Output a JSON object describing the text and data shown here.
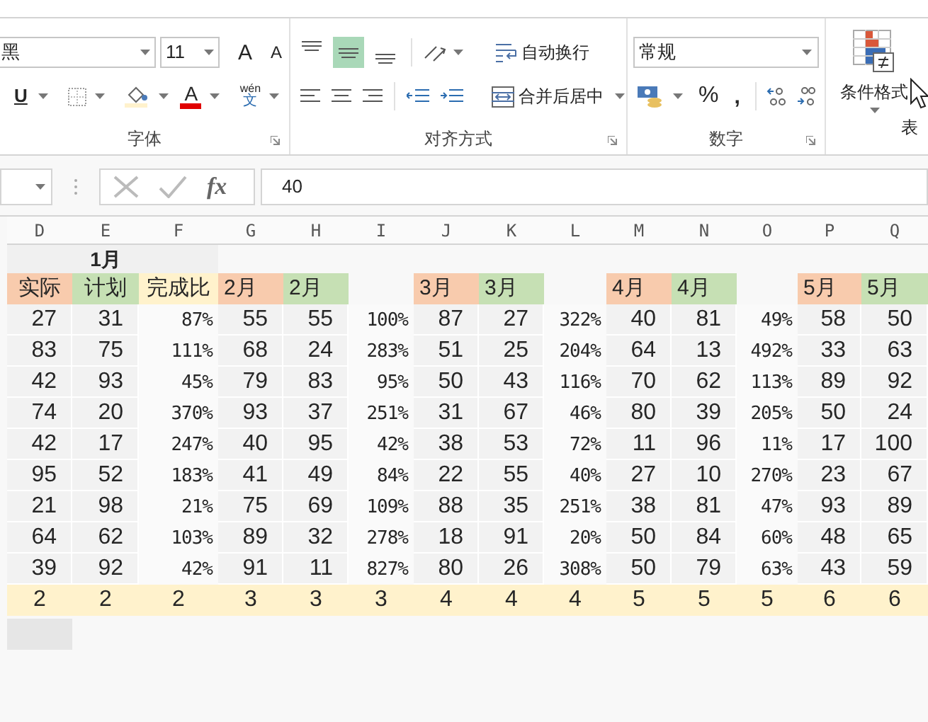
{
  "font_group": {
    "font_name": "黑",
    "font_size": "11",
    "grow": "A",
    "shrink": "A",
    "underline": "U",
    "font_color": "A",
    "phonetic_top": "wén",
    "phonetic_bottom": "文",
    "label": "字体"
  },
  "alignment_group": {
    "vertical_align": [
      {
        "kind": "top",
        "selected": false
      },
      {
        "kind": "middle",
        "selected": true
      },
      {
        "kind": "bottom",
        "selected": false
      }
    ],
    "wrap_text": "自动换行",
    "merge_center": "合并后居中",
    "label": "对齐方式"
  },
  "number_group": {
    "format": "常规",
    "percent": "%",
    "comma": ",",
    "label": "数字"
  },
  "styles_group": {
    "conditional_formatting": "条件格式",
    "table_label": "表"
  },
  "formula_bar": {
    "function_label": "fx",
    "value": "40"
  },
  "sheet": {
    "columns": [
      "D",
      "E",
      "F",
      "G",
      "H",
      "I",
      "J",
      "K",
      "L",
      "M",
      "N",
      "O",
      "P",
      "Q"
    ],
    "title": "1月",
    "header_cells": [
      {
        "text": "实际",
        "kind": "actual"
      },
      {
        "text": "计划",
        "kind": "plan"
      },
      {
        "text": "完成比",
        "kind": "ratio"
      },
      {
        "text": "2月",
        "kind": "actual"
      },
      {
        "text": "2月",
        "kind": "plan"
      },
      {
        "kind": "blank"
      },
      {
        "text": "3月",
        "kind": "actual"
      },
      {
        "text": "3月",
        "kind": "plan"
      },
      {
        "kind": "blank"
      },
      {
        "text": "4月",
        "kind": "actual"
      },
      {
        "text": "4月",
        "kind": "plan"
      },
      {
        "kind": "blank"
      },
      {
        "text": "5月",
        "kind": "actual"
      },
      {
        "text": "5月",
        "kind": "plan"
      }
    ],
    "rows": [
      [
        "27",
        "31",
        "87%",
        "55",
        "55",
        "100%",
        "87",
        "27",
        "322%",
        "40",
        "81",
        "49%",
        "58",
        "50"
      ],
      [
        "83",
        "75",
        "111%",
        "68",
        "24",
        "283%",
        "51",
        "25",
        "204%",
        "64",
        "13",
        "492%",
        "33",
        "63"
      ],
      [
        "42",
        "93",
        "45%",
        "79",
        "83",
        "95%",
        "50",
        "43",
        "116%",
        "70",
        "62",
        "113%",
        "89",
        "92"
      ],
      [
        "74",
        "20",
        "370%",
        "93",
        "37",
        "251%",
        "31",
        "67",
        "46%",
        "80",
        "39",
        "205%",
        "50",
        "24"
      ],
      [
        "42",
        "17",
        "247%",
        "40",
        "95",
        "42%",
        "38",
        "53",
        "72%",
        "11",
        "96",
        "11%",
        "17",
        "100"
      ],
      [
        "95",
        "52",
        "183%",
        "41",
        "49",
        "84%",
        "22",
        "55",
        "40%",
        "27",
        "10",
        "270%",
        "23",
        "67"
      ],
      [
        "21",
        "98",
        "21%",
        "75",
        "69",
        "109%",
        "88",
        "35",
        "251%",
        "38",
        "81",
        "47%",
        "93",
        "89"
      ],
      [
        "64",
        "62",
        "103%",
        "89",
        "32",
        "278%",
        "18",
        "91",
        "20%",
        "50",
        "84",
        "60%",
        "48",
        "65"
      ],
      [
        "39",
        "92",
        "42%",
        "91",
        "11",
        "827%",
        "80",
        "26",
        "308%",
        "50",
        "79",
        "63%",
        "43",
        "59"
      ]
    ],
    "totals": [
      "2",
      "2",
      "2",
      "3",
      "3",
      "3",
      "4",
      "4",
      "4",
      "5",
      "5",
      "5",
      "6",
      "6"
    ]
  }
}
